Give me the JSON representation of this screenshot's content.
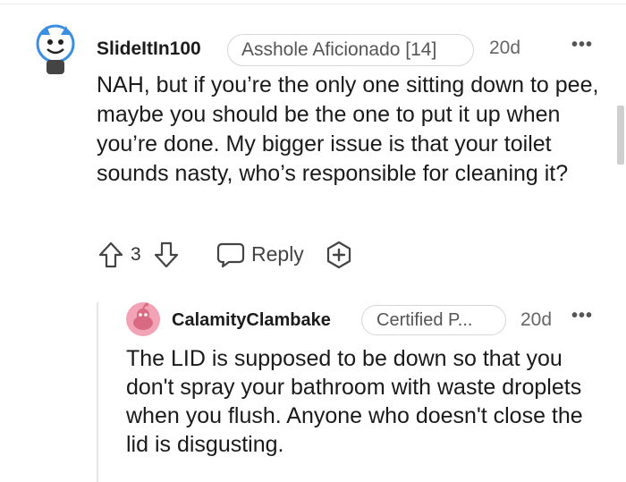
{
  "comment": {
    "username": "SlideItIn100",
    "flair": "Asshole Aficionado [14]",
    "age": "20d",
    "more": "•••",
    "body": "NAH, but if you’re the only one sitting down to pee, maybe you should be the one to put it up when you’re done. My bigger issue is that your toilet sounds nasty, who’s responsible for cleaning it?",
    "score": "3",
    "reply_label": "Reply"
  },
  "reply": {
    "username": "CalamityClambake",
    "flair": "Certified P...",
    "age": "20d",
    "more": "•••",
    "body": "The LID is supposed to be down so that you don't spray your bathroom with waste droplets when you flush. Anyone who doesn't close the lid is disgusting."
  },
  "icons": [
    "avatar-icon",
    "upvote-icon",
    "downvote-icon",
    "reply-icon",
    "award-icon",
    "more-options-icon"
  ],
  "colors": {
    "text": "#1a1a1b",
    "meta": "#666666",
    "avatar2_bg": "#f2a3b5",
    "avatar1_accent": "#3b8ee0"
  }
}
